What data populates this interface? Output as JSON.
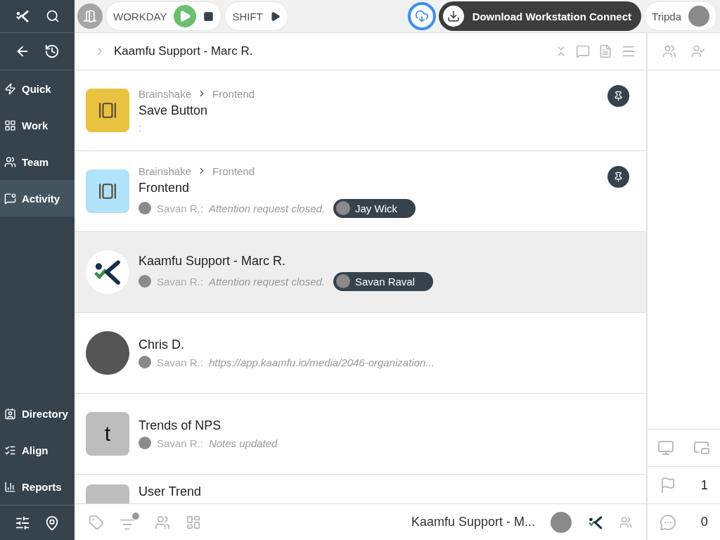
{
  "sidebar": {
    "items": [
      {
        "label": "Quick",
        "selected": false
      },
      {
        "label": "Work",
        "selected": false
      },
      {
        "label": "Team",
        "selected": false
      },
      {
        "label": "Activity",
        "selected": true
      }
    ],
    "bottom_items": [
      {
        "label": "Directory"
      },
      {
        "label": "Align"
      },
      {
        "label": "Reports"
      }
    ]
  },
  "topbar": {
    "workday": {
      "label": "WORKDAY"
    },
    "shift": {
      "label": "SHIFT"
    },
    "download": {
      "label": "Download Workstation Connect"
    },
    "user": {
      "name": "Tripda"
    }
  },
  "header": {
    "title": "Kaamfu Support - Marc R."
  },
  "feed": [
    {
      "thumb": {
        "kind": "icon",
        "color": "#e9c23f"
      },
      "breadcrumb": [
        "Brainshake",
        "Frontend"
      ],
      "title": "Save Button",
      "separator": ":",
      "pinned": true,
      "selected": false
    },
    {
      "thumb": {
        "kind": "icon",
        "color": "#aee3f9"
      },
      "breadcrumb": [
        "Brainshake",
        "Frontend"
      ],
      "title": "Frontend",
      "author": "Savan R.:",
      "message": "Attention request closed.",
      "chip": "Jay Wick",
      "pinned": true,
      "selected": false
    },
    {
      "thumb": {
        "kind": "logo"
      },
      "title": "Kaamfu Support - Marc R.",
      "author": "Savan R.:",
      "message": "Attention request closed.",
      "chip": "Savan Raval",
      "pinned": false,
      "selected": true
    },
    {
      "thumb": {
        "kind": "photo"
      },
      "title": "Chris D.",
      "author": "Savan R.:",
      "message": "https://app.kaamfu.io/media/2046-organization...",
      "pinned": false,
      "selected": false
    },
    {
      "thumb": {
        "kind": "letter",
        "letter": "t",
        "color": "#bdbdbd"
      },
      "title": "Trends of NPS",
      "author": "Savan R.:",
      "message": "Notes updated",
      "pinned": false,
      "selected": false
    },
    {
      "thumb": {
        "kind": "letter",
        "color": "#bdbdbd"
      },
      "title": "User Trend",
      "pinned": false,
      "selected": false
    }
  ],
  "footer": {
    "title": "Kaamfu Support - M..."
  },
  "right_panel": {
    "flags": "1",
    "comments": "0"
  }
}
